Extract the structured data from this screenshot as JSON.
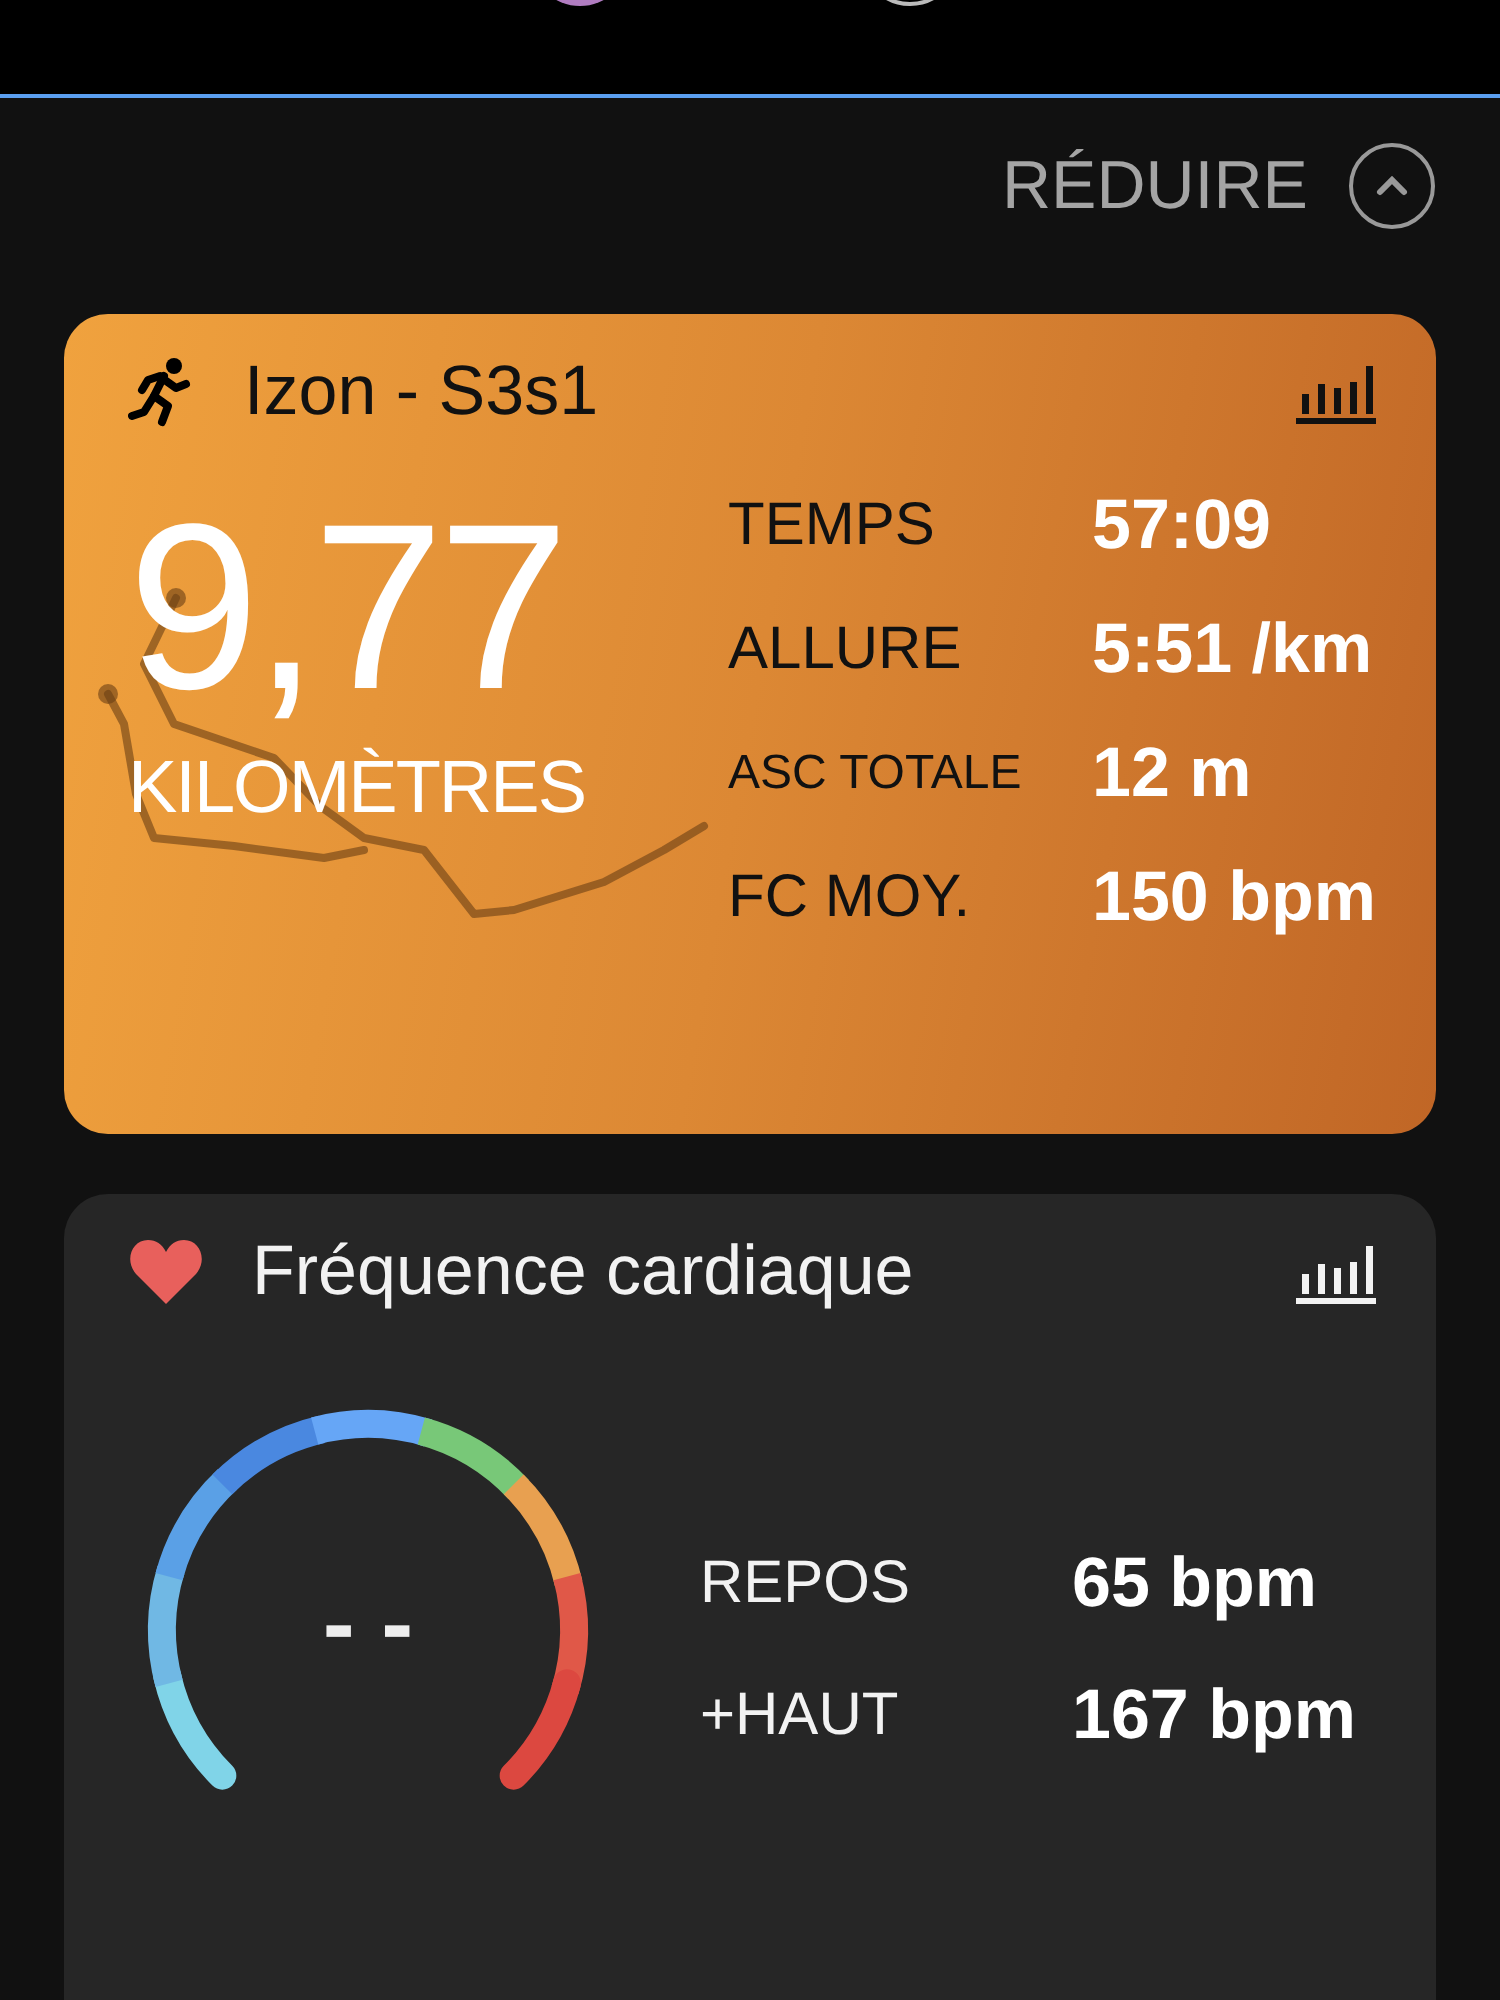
{
  "collapse": {
    "label": "RÉDUIRE"
  },
  "activity": {
    "title": "Izon - S3s1",
    "distance": "9,77",
    "unit": "KILOMÈTRES",
    "stats": [
      {
        "label": "TEMPS",
        "value": "57:09",
        "kind": "normal"
      },
      {
        "label": "ALLURE",
        "value": "5:51 /km",
        "kind": "normal"
      },
      {
        "label": "ASC TOTALE",
        "value": "12 m",
        "kind": "small"
      },
      {
        "label": "FC MOY.",
        "value": "150 bpm",
        "kind": "normal"
      }
    ]
  },
  "heart_rate": {
    "title": "Fréquence cardiaque",
    "current": "- -",
    "stats": [
      {
        "label": "REPOS",
        "value": "65 bpm"
      },
      {
        "label": "+HAUT",
        "value": "167 bpm"
      }
    ]
  }
}
